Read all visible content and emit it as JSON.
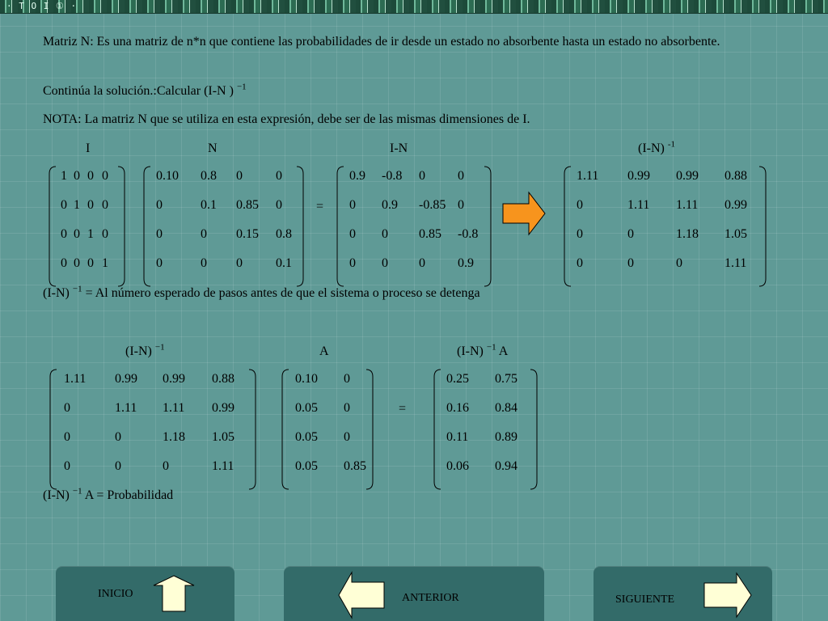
{
  "header": {
    "glyphs": "· T O I ① ·"
  },
  "text": {
    "para1": "Matriz N: Es una matriz de n*n que contiene las probabilidades de ir desde un estado no absorbente hasta un estado no absorbente.",
    "para2_main": "Continúa la solución.:Calcular (I-N )",
    "para3": "NOTA: La matriz N que se utiliza en esta expresión, debe ser de las mismas dimensiones de I.",
    "def1_main": "(I-N)",
    "def1_rest": "= Al  número esperado de pasos antes de que el sistema o proceso se detenga",
    "def2_main": "(I-N)",
    "def2_rest": "A = Probabilidad",
    "inv_exp": "−1",
    "inv_exp_alt": "-1"
  },
  "eq1": {
    "labels": {
      "I": "I",
      "N": "N",
      "IN": "I-N",
      "INinv": "(I-N)"
    },
    "equals": "=",
    "I": [
      [
        "1",
        "0",
        "0",
        "0"
      ],
      [
        "0",
        "1",
        "0",
        "0"
      ],
      [
        "0",
        "0",
        "1",
        "0"
      ],
      [
        "0",
        "0",
        "0",
        "1"
      ]
    ],
    "N": [
      [
        "0.10",
        "0.8",
        "0",
        "0"
      ],
      [
        "0",
        "0.1",
        "0.85",
        "0"
      ],
      [
        "0",
        "0",
        "0.15",
        "0.8"
      ],
      [
        "0",
        "0",
        "0",
        "0.1"
      ]
    ],
    "IN": [
      [
        "0.9",
        "-0.8",
        "0",
        "0"
      ],
      [
        "0",
        "0.9",
        "-0.85",
        "0"
      ],
      [
        "0",
        "0",
        "0.85",
        "-0.8"
      ],
      [
        "0",
        "0",
        "0",
        "0.9"
      ]
    ],
    "INinv": [
      [
        "1.11",
        "0.99",
        "0.99",
        "0.88"
      ],
      [
        "0",
        "1.11",
        "1.11",
        "0.99"
      ],
      [
        "0",
        "0",
        "1.18",
        "1.05"
      ],
      [
        "0",
        "0",
        "0",
        "1.11"
      ]
    ]
  },
  "eq2": {
    "labels": {
      "INinv": "(I-N)",
      "A": "A",
      "INinvA": "(I-N)",
      "INinvA_suffix": "A"
    },
    "equals": "=",
    "INinv": [
      [
        "1.11",
        "0.99",
        "0.99",
        "0.88"
      ],
      [
        "0",
        "1.11",
        "1.11",
        "0.99"
      ],
      [
        "0",
        "0",
        "1.18",
        "1.05"
      ],
      [
        "0",
        "0",
        "0",
        "1.11"
      ]
    ],
    "A": [
      [
        "0.10",
        "0"
      ],
      [
        "0.05",
        "0"
      ],
      [
        "0.05",
        "0"
      ],
      [
        "0.05",
        "0.85"
      ]
    ],
    "INinvA": [
      [
        "0.25",
        "0.75"
      ],
      [
        "0.16",
        "0.84"
      ],
      [
        "0.11",
        "0.89"
      ],
      [
        "0.06",
        "0.94"
      ]
    ]
  },
  "nav": {
    "inicio": "INICIO",
    "anterior": "ANTERIOR",
    "siguiente": "SIGUIENTE"
  },
  "colors": {
    "background": "#5f9a96",
    "nav_panel": "#336b69",
    "arrow_orange": "#f7941d",
    "nav_arrow": "#ffffd6"
  }
}
